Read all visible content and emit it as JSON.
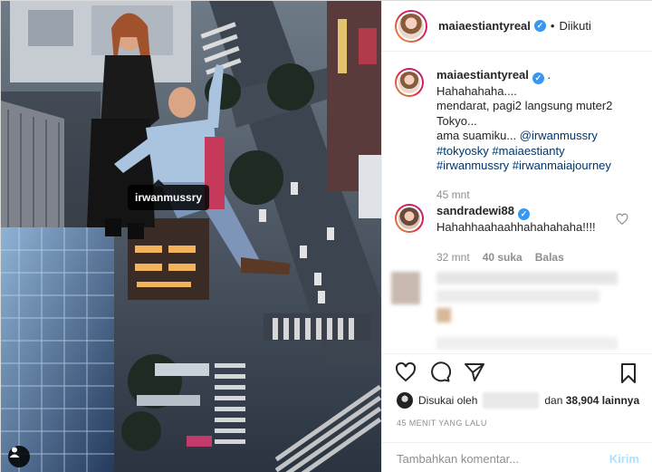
{
  "photo": {
    "tagged_user": "irwanmussry"
  },
  "header": {
    "username": "maiaestiantyreal",
    "follow_status": "Diikuti",
    "separator": "•"
  },
  "caption": {
    "username": "maiaestiantyreal",
    "lines": [
      ".",
      "Hahahahaha....",
      "mendarat, pagi2 langsung muter2",
      "Tokyo...",
      "ama suamiku... @irwanmussry",
      "#tokyosky #maiaestianty",
      "#irwanmussry #irwanmaiajourney"
    ],
    "mention": "@irwanmussry",
    "line5_prefix": "ama suamiku... ",
    "hashtags_line1": "#tokyosky #maiaestianty",
    "hashtags_line2": "#irwanmussry #irwanmaiajourney",
    "time": "45 mnt"
  },
  "comment": {
    "username": "sandradewi88",
    "text": "Hahahhaahaahhahahahaha!!!!",
    "time": "32 mnt",
    "likes": "40 suka",
    "reply": "Balas"
  },
  "likes": {
    "prefix": "Disukai oleh",
    "middle": "dan",
    "count": "38,904",
    "suffix": "lainnya"
  },
  "timestamp": "45 MENIT YANG LALU",
  "input": {
    "placeholder": "Tambahkan komentar...",
    "post_label": "Kirim"
  },
  "icons": {
    "like": "heart-icon",
    "comment": "comment-icon",
    "share": "share-icon",
    "save": "bookmark-icon",
    "verified": "verified-badge-icon",
    "user_tags": "user-tag-icon"
  },
  "colors": {
    "verified": "#3897f0",
    "hashtag": "#003569",
    "muted": "#8e8e8e",
    "post_disabled": "#b2dffc"
  }
}
